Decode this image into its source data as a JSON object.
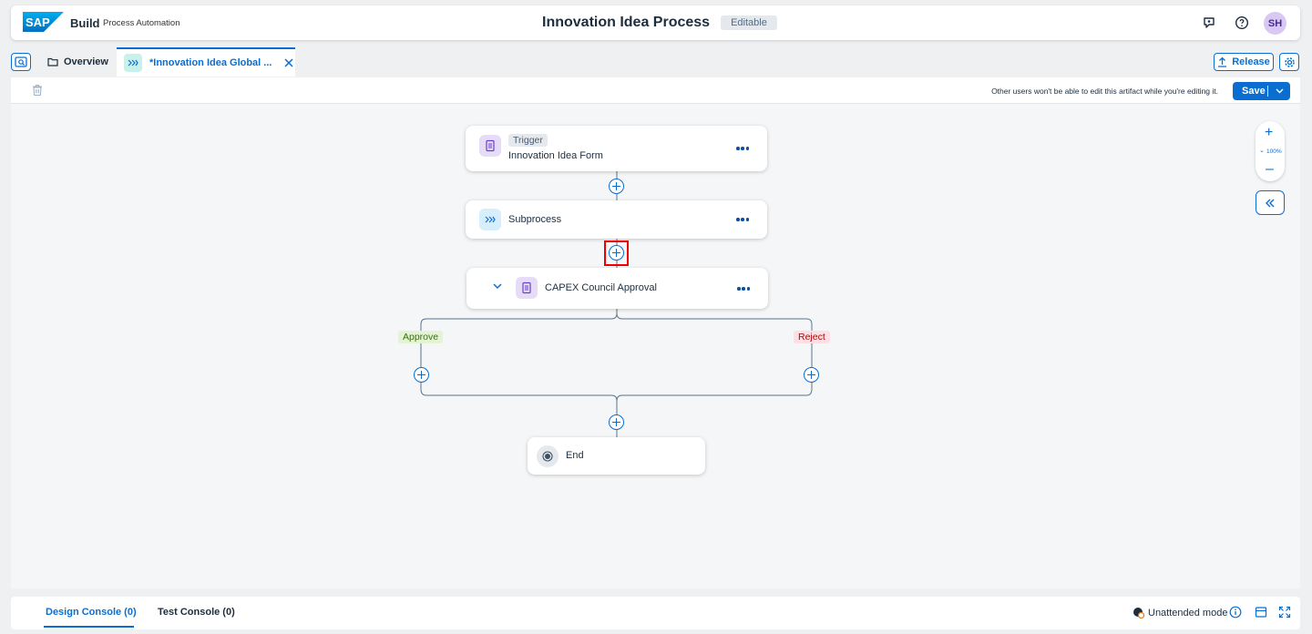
{
  "shell": {
    "brand_logo_text": "SAP",
    "app_name": "Build",
    "app_subtitle": "Process Automation",
    "title": "Innovation Idea Process",
    "status_badge": "Editable",
    "avatar_initials": "SH",
    "icons": [
      "feedback-icon",
      "help-icon"
    ]
  },
  "tabs": {
    "overview_label": "Overview",
    "active_tab_label": "*Innovation Idea Global ...",
    "release_label": "Release"
  },
  "toolbar": {
    "notice": "Other users won't be able to edit this artifact while you're editing it.",
    "save_label": "Save"
  },
  "canvas": {
    "trigger_chip": "Trigger",
    "trigger_form": "Innovation Idea Form",
    "subprocess_label": "Subprocess",
    "approval_label": "CAPEX Council Approval",
    "branch_approve": "Approve",
    "branch_reject": "Reject",
    "end_label": "End",
    "zoom_level": "100%"
  },
  "console": {
    "design_tab": "Design Console (0)",
    "test_tab": "Test Console (0)",
    "mode_label": "Unattended mode"
  },
  "colors": {
    "accent": "#0a6ed1",
    "highlight": "#ee0000"
  }
}
